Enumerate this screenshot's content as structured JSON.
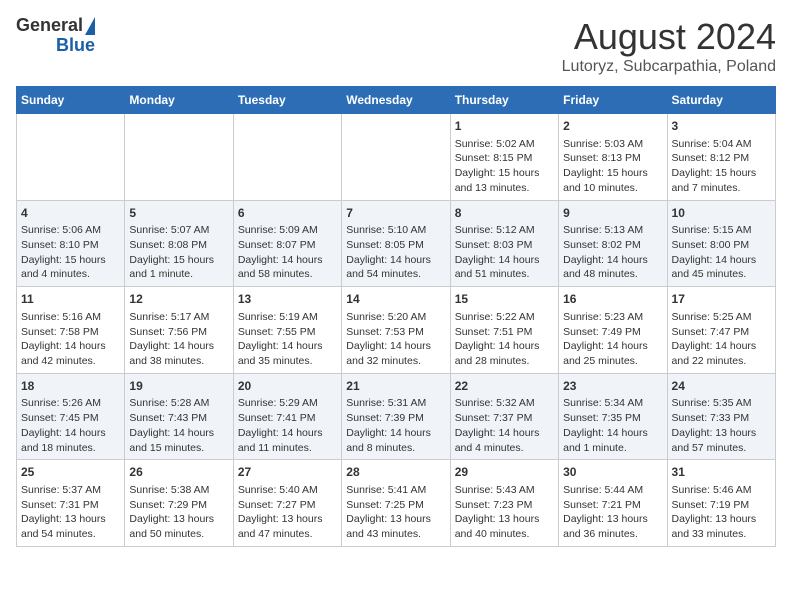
{
  "header": {
    "logo_general": "General",
    "logo_blue": "Blue",
    "title": "August 2024",
    "subtitle": "Lutoryz, Subcarpathia, Poland"
  },
  "days_of_week": [
    "Sunday",
    "Monday",
    "Tuesday",
    "Wednesday",
    "Thursday",
    "Friday",
    "Saturday"
  ],
  "weeks": [
    [
      {
        "day": "",
        "content": ""
      },
      {
        "day": "",
        "content": ""
      },
      {
        "day": "",
        "content": ""
      },
      {
        "day": "",
        "content": ""
      },
      {
        "day": "1",
        "content": "Sunrise: 5:02 AM\nSunset: 8:15 PM\nDaylight: 15 hours\nand 13 minutes."
      },
      {
        "day": "2",
        "content": "Sunrise: 5:03 AM\nSunset: 8:13 PM\nDaylight: 15 hours\nand 10 minutes."
      },
      {
        "day": "3",
        "content": "Sunrise: 5:04 AM\nSunset: 8:12 PM\nDaylight: 15 hours\nand 7 minutes."
      }
    ],
    [
      {
        "day": "4",
        "content": "Sunrise: 5:06 AM\nSunset: 8:10 PM\nDaylight: 15 hours\nand 4 minutes."
      },
      {
        "day": "5",
        "content": "Sunrise: 5:07 AM\nSunset: 8:08 PM\nDaylight: 15 hours\nand 1 minute."
      },
      {
        "day": "6",
        "content": "Sunrise: 5:09 AM\nSunset: 8:07 PM\nDaylight: 14 hours\nand 58 minutes."
      },
      {
        "day": "7",
        "content": "Sunrise: 5:10 AM\nSunset: 8:05 PM\nDaylight: 14 hours\nand 54 minutes."
      },
      {
        "day": "8",
        "content": "Sunrise: 5:12 AM\nSunset: 8:03 PM\nDaylight: 14 hours\nand 51 minutes."
      },
      {
        "day": "9",
        "content": "Sunrise: 5:13 AM\nSunset: 8:02 PM\nDaylight: 14 hours\nand 48 minutes."
      },
      {
        "day": "10",
        "content": "Sunrise: 5:15 AM\nSunset: 8:00 PM\nDaylight: 14 hours\nand 45 minutes."
      }
    ],
    [
      {
        "day": "11",
        "content": "Sunrise: 5:16 AM\nSunset: 7:58 PM\nDaylight: 14 hours\nand 42 minutes."
      },
      {
        "day": "12",
        "content": "Sunrise: 5:17 AM\nSunset: 7:56 PM\nDaylight: 14 hours\nand 38 minutes."
      },
      {
        "day": "13",
        "content": "Sunrise: 5:19 AM\nSunset: 7:55 PM\nDaylight: 14 hours\nand 35 minutes."
      },
      {
        "day": "14",
        "content": "Sunrise: 5:20 AM\nSunset: 7:53 PM\nDaylight: 14 hours\nand 32 minutes."
      },
      {
        "day": "15",
        "content": "Sunrise: 5:22 AM\nSunset: 7:51 PM\nDaylight: 14 hours\nand 28 minutes."
      },
      {
        "day": "16",
        "content": "Sunrise: 5:23 AM\nSunset: 7:49 PM\nDaylight: 14 hours\nand 25 minutes."
      },
      {
        "day": "17",
        "content": "Sunrise: 5:25 AM\nSunset: 7:47 PM\nDaylight: 14 hours\nand 22 minutes."
      }
    ],
    [
      {
        "day": "18",
        "content": "Sunrise: 5:26 AM\nSunset: 7:45 PM\nDaylight: 14 hours\nand 18 minutes."
      },
      {
        "day": "19",
        "content": "Sunrise: 5:28 AM\nSunset: 7:43 PM\nDaylight: 14 hours\nand 15 minutes."
      },
      {
        "day": "20",
        "content": "Sunrise: 5:29 AM\nSunset: 7:41 PM\nDaylight: 14 hours\nand 11 minutes."
      },
      {
        "day": "21",
        "content": "Sunrise: 5:31 AM\nSunset: 7:39 PM\nDaylight: 14 hours\nand 8 minutes."
      },
      {
        "day": "22",
        "content": "Sunrise: 5:32 AM\nSunset: 7:37 PM\nDaylight: 14 hours\nand 4 minutes."
      },
      {
        "day": "23",
        "content": "Sunrise: 5:34 AM\nSunset: 7:35 PM\nDaylight: 14 hours\nand 1 minute."
      },
      {
        "day": "24",
        "content": "Sunrise: 5:35 AM\nSunset: 7:33 PM\nDaylight: 13 hours\nand 57 minutes."
      }
    ],
    [
      {
        "day": "25",
        "content": "Sunrise: 5:37 AM\nSunset: 7:31 PM\nDaylight: 13 hours\nand 54 minutes."
      },
      {
        "day": "26",
        "content": "Sunrise: 5:38 AM\nSunset: 7:29 PM\nDaylight: 13 hours\nand 50 minutes."
      },
      {
        "day": "27",
        "content": "Sunrise: 5:40 AM\nSunset: 7:27 PM\nDaylight: 13 hours\nand 47 minutes."
      },
      {
        "day": "28",
        "content": "Sunrise: 5:41 AM\nSunset: 7:25 PM\nDaylight: 13 hours\nand 43 minutes."
      },
      {
        "day": "29",
        "content": "Sunrise: 5:43 AM\nSunset: 7:23 PM\nDaylight: 13 hours\nand 40 minutes."
      },
      {
        "day": "30",
        "content": "Sunrise: 5:44 AM\nSunset: 7:21 PM\nDaylight: 13 hours\nand 36 minutes."
      },
      {
        "day": "31",
        "content": "Sunrise: 5:46 AM\nSunset: 7:19 PM\nDaylight: 13 hours\nand 33 minutes."
      }
    ]
  ]
}
